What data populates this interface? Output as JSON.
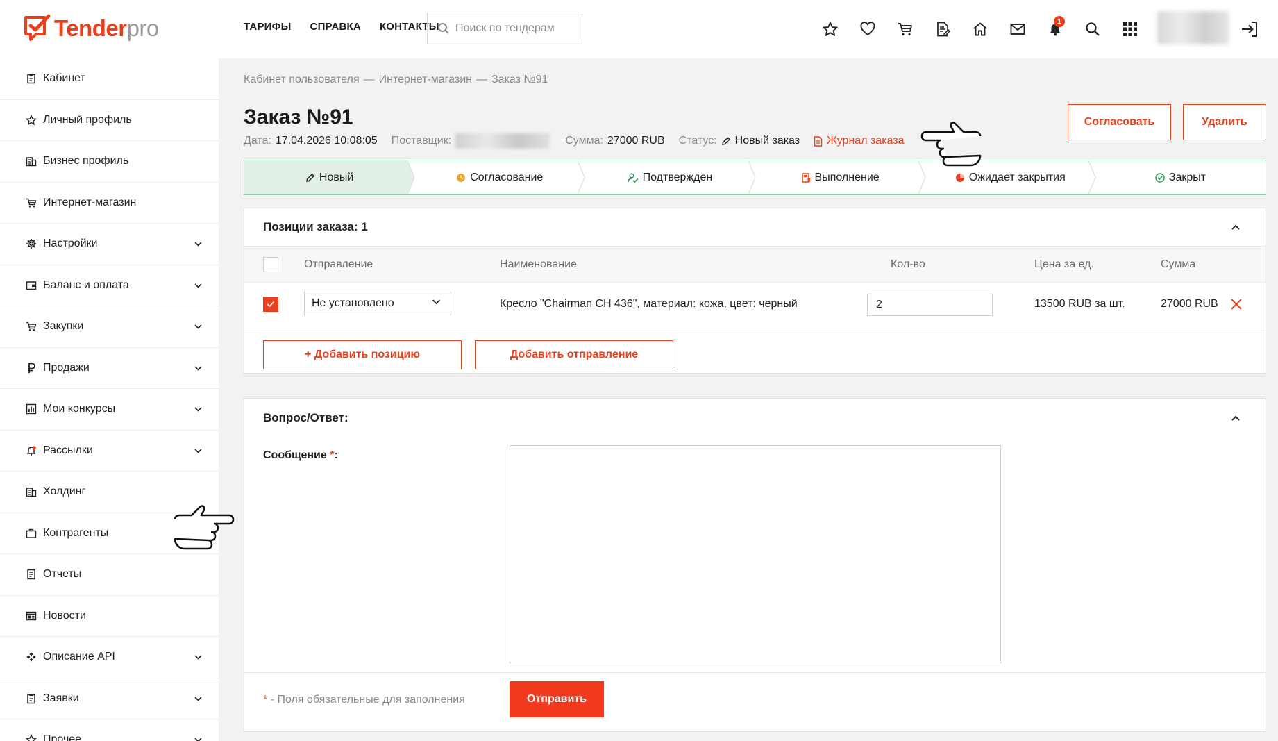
{
  "brand": {
    "name_main": "Tender",
    "name_suffix": "pro"
  },
  "topnav": [
    "ТАРИФЫ",
    "СПРАВКА",
    "КОНТАКТЫ"
  ],
  "search": {
    "placeholder": "Поиск по тендерам"
  },
  "header_icons": [
    "star-icon",
    "heart-icon",
    "cart-icon",
    "document-edit-icon",
    "home-icon",
    "mail-icon",
    "bell-icon",
    "search-icon",
    "apps-grid-icon"
  ],
  "notifications": {
    "count": "1"
  },
  "sidebar": {
    "items": [
      {
        "label": "Кабинет",
        "icon": "clipboard-icon",
        "expandable": false
      },
      {
        "label": "Личный профиль",
        "icon": "star-icon",
        "expandable": false
      },
      {
        "label": "Бизнес профиль",
        "icon": "building-icon",
        "expandable": false
      },
      {
        "label": "Интернет-магазин",
        "icon": "cart-icon",
        "expandable": false
      },
      {
        "label": "Настройки",
        "icon": "gear-icon",
        "expandable": true
      },
      {
        "label": "Баланс и оплата",
        "icon": "wallet-icon",
        "expandable": true
      },
      {
        "label": "Закупки",
        "icon": "cart-icon",
        "expandable": true
      },
      {
        "label": "Продажи",
        "icon": "ruble-icon",
        "expandable": true
      },
      {
        "label": "Мои конкурсы",
        "icon": "bar-chart-icon",
        "expandable": true
      },
      {
        "label": "Рассылки",
        "icon": "bell-icon",
        "expandable": true
      },
      {
        "label": "Холдинг",
        "icon": "building-icon",
        "expandable": false
      },
      {
        "label": "Контрагенты",
        "icon": "briefcase-icon",
        "expandable": false
      },
      {
        "label": "Отчеты",
        "icon": "report-icon",
        "expandable": false
      },
      {
        "label": "Новости",
        "icon": "news-icon",
        "expandable": false
      },
      {
        "label": "Описание API",
        "icon": "api-icon",
        "expandable": true
      },
      {
        "label": "Заявки",
        "icon": "clipboard-icon",
        "expandable": true
      },
      {
        "label": "Прочее",
        "icon": "star-icon",
        "expandable": true
      }
    ]
  },
  "breadcrumb": [
    "Кабинет пользователя",
    "Интернет-магазин",
    "Заказ №91"
  ],
  "order": {
    "title": "Заказ №91",
    "date_label": "Дата:",
    "date_value": "17.04.2026 10:08:05",
    "supplier_label": "Поставщик:",
    "sum_label": "Сумма:",
    "sum_value": "27000 RUB",
    "status_label": "Статус:",
    "status_value": "Новый заказ",
    "journal_label": "Журнал заказа",
    "approve_button": "Согласовать",
    "delete_button": "Удалить"
  },
  "steps": [
    {
      "label": "Новый",
      "icon": "pencil-icon",
      "active": true
    },
    {
      "label": "Согласование",
      "icon": "clock-icon",
      "active": false
    },
    {
      "label": "Подтвержден",
      "icon": "user-check-icon",
      "active": false
    },
    {
      "label": "Выполнение",
      "icon": "progress-icon",
      "active": false
    },
    {
      "label": "Ожидает закрытия",
      "icon": "pie-icon",
      "active": false
    },
    {
      "label": "Закрыт",
      "icon": "check-circle-icon",
      "active": false
    }
  ],
  "positions": {
    "heading": "Позиции заказа: 1",
    "columns": [
      "Отправление",
      "Наименование",
      "Кол-во",
      "Цена за ед.",
      "Сумма"
    ],
    "rows": [
      {
        "checked": true,
        "shipment": "Не установлено",
        "name": "Кресло \"Chairman CH 436\", материал: кожа, цвет: черный",
        "qty": "2",
        "price": "13500 RUB за шт.",
        "sum": "27000 RUB"
      }
    ],
    "add_position_button": "+ Добавить позицию",
    "add_shipment_button": "Добавить отправление"
  },
  "qa": {
    "heading": "Вопрос/Ответ:",
    "message_label": "Сообщение",
    "required_mark": "*",
    "colon": ":",
    "required_note_mark": "*",
    "required_note": " - Поля обязательные для заполнения",
    "send_button": "Отправить"
  },
  "colors": {
    "accent": "#e8401c",
    "step_border": "#8fd0a8",
    "step_active_bg": "#e3f0e7",
    "main_bg": "#f2f2f2"
  }
}
